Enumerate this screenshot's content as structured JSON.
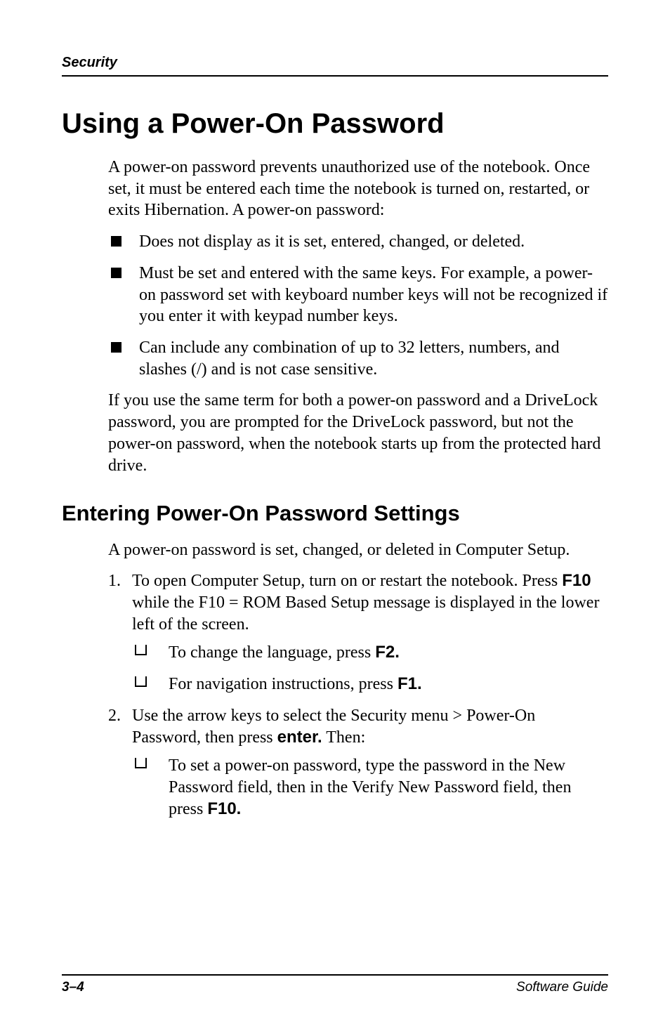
{
  "header": {
    "running": "Security"
  },
  "h1": "Using a Power-On Password",
  "intro": "A power-on password prevents unauthorized use of the notebook. Once set, it must be entered each time the notebook is turned on, restarted, or exits Hibernation. A power-on password:",
  "bullets": {
    "b1": "Does not display as it is set, entered, changed, or deleted.",
    "b2": "Must be set and entered with the same keys. For example, a power-on password set with keyboard number keys will not be recognized if you enter it with keypad number keys.",
    "b3": "Can include any combination of up to 32 letters, numbers, and slashes (/) and is not case sensitive."
  },
  "para_after_bullets": "If you use the same term for both a power-on password and a DriveLock password, you are prompted for the DriveLock password, but not the power-on password, when the notebook starts up from the protected hard drive.",
  "h2": "Entering Power-On Password Settings",
  "sub_intro": "A power-on password is set, changed, or deleted in Computer Setup.",
  "steps": {
    "s1_a": "To open Computer Setup, turn on or restart the notebook. Press ",
    "s1_key": "F10",
    "s1_b": " while the F10 = ROM Based Setup message is displayed in the lower left of the screen.",
    "s1_sub1_a": "To change the language, press ",
    "s1_sub1_key": "F2.",
    "s1_sub2_a": "For navigation instructions, press ",
    "s1_sub2_key": "F1.",
    "s2_a": "Use the arrow keys to select the Security menu > Power-On Password, then press ",
    "s2_key": "enter.",
    "s2_b": " Then:",
    "s2_sub1_a": "To set a power-on password, type the password in the New Password field, then in the Verify New Password field, then press ",
    "s2_sub1_key": "F10."
  },
  "footer": {
    "left": "3–4",
    "right": "Software Guide"
  }
}
